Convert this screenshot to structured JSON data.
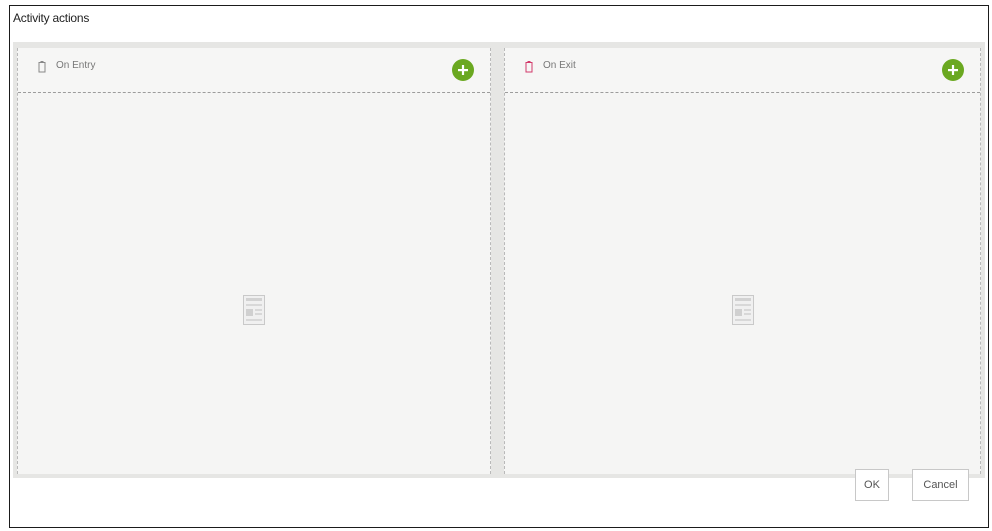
{
  "dialog": {
    "title": "Activity actions"
  },
  "panels": [
    {
      "label": "On Entry",
      "icon": "entry-icon",
      "add_icon": "plus-circle-icon",
      "empty_icon": "placeholder-form-icon"
    },
    {
      "label": "On Exit",
      "icon": "exit-icon",
      "add_icon": "plus-circle-icon",
      "empty_icon": "placeholder-form-icon"
    }
  ],
  "footer": {
    "ok_label": "OK",
    "cancel_label": "Cancel"
  },
  "colors": {
    "add_button": "#6aa820",
    "panel_background": "#f5f5f4",
    "panel_container": "#e6e6e4",
    "exit_icon": "#d23a6a"
  }
}
